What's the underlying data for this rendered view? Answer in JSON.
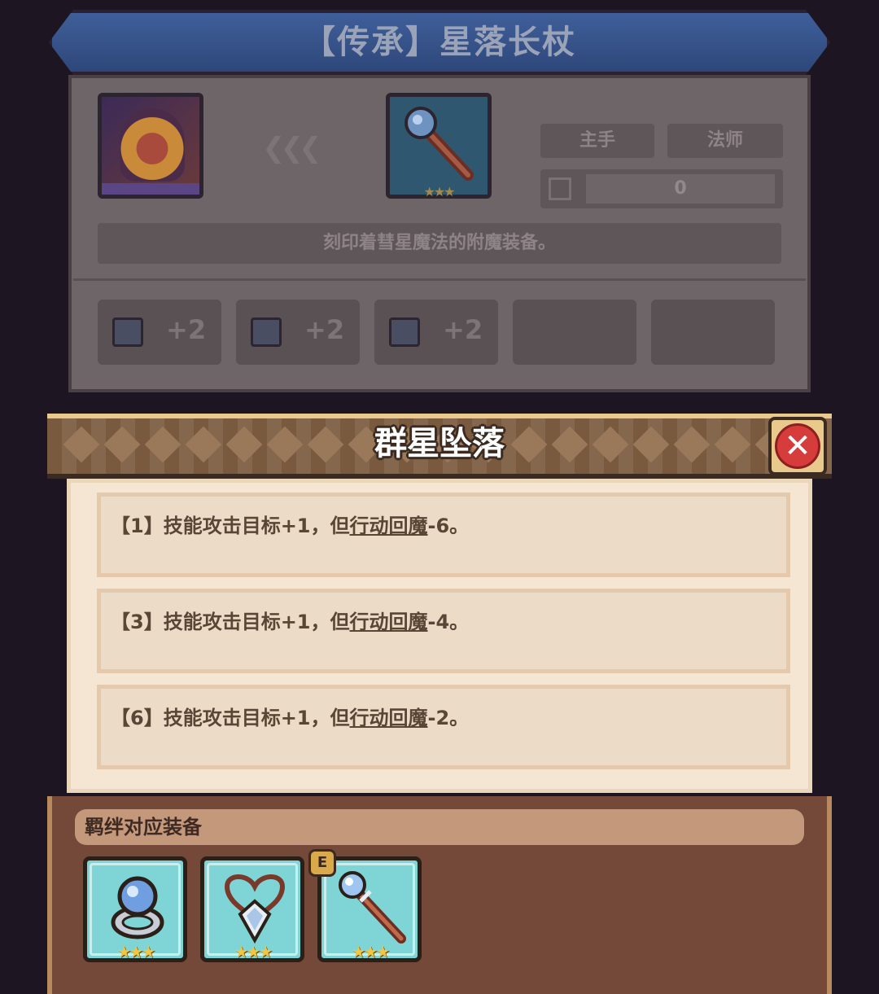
{
  "item": {
    "title": "【传承】星落长杖",
    "slot_type": "主手",
    "class_type": "法师",
    "count_value": "0",
    "description": "刻印着彗星魔法的附魔装备。",
    "stars": "★★★",
    "stats": [
      {
        "icon": "book-icon",
        "value": "+2"
      },
      {
        "icon": "boot-icon",
        "value": "+2"
      },
      {
        "icon": "stone-icon",
        "value": "+2"
      }
    ]
  },
  "popup": {
    "title": "群星坠落",
    "effects": [
      {
        "tier": "【1】",
        "pre": "技能攻击目标+1，但",
        "keyword": "行动回魔",
        "post": "-6。"
      },
      {
        "tier": "【3】",
        "pre": "技能攻击目标+1，但",
        "keyword": "行动回魔",
        "post": "-4。"
      },
      {
        "tier": "【6】",
        "pre": "技能攻击目标+1，但",
        "keyword": "行动回魔",
        "post": "-2。"
      }
    ],
    "bond_title": "羁绊对应装备",
    "equipment": [
      {
        "icon": "ring-icon",
        "stars": "★★★"
      },
      {
        "icon": "necklace-icon",
        "stars": "★★★"
      },
      {
        "icon": "staff-icon",
        "stars": "★★★",
        "badge": "E"
      }
    ]
  },
  "colors": {
    "popup_header": "#7a5a3e",
    "popup_body": "#f4e6d2",
    "close_red": "#d63c3c",
    "equip_bg": "#7fd4d6",
    "star_gold": "#f2c640"
  }
}
